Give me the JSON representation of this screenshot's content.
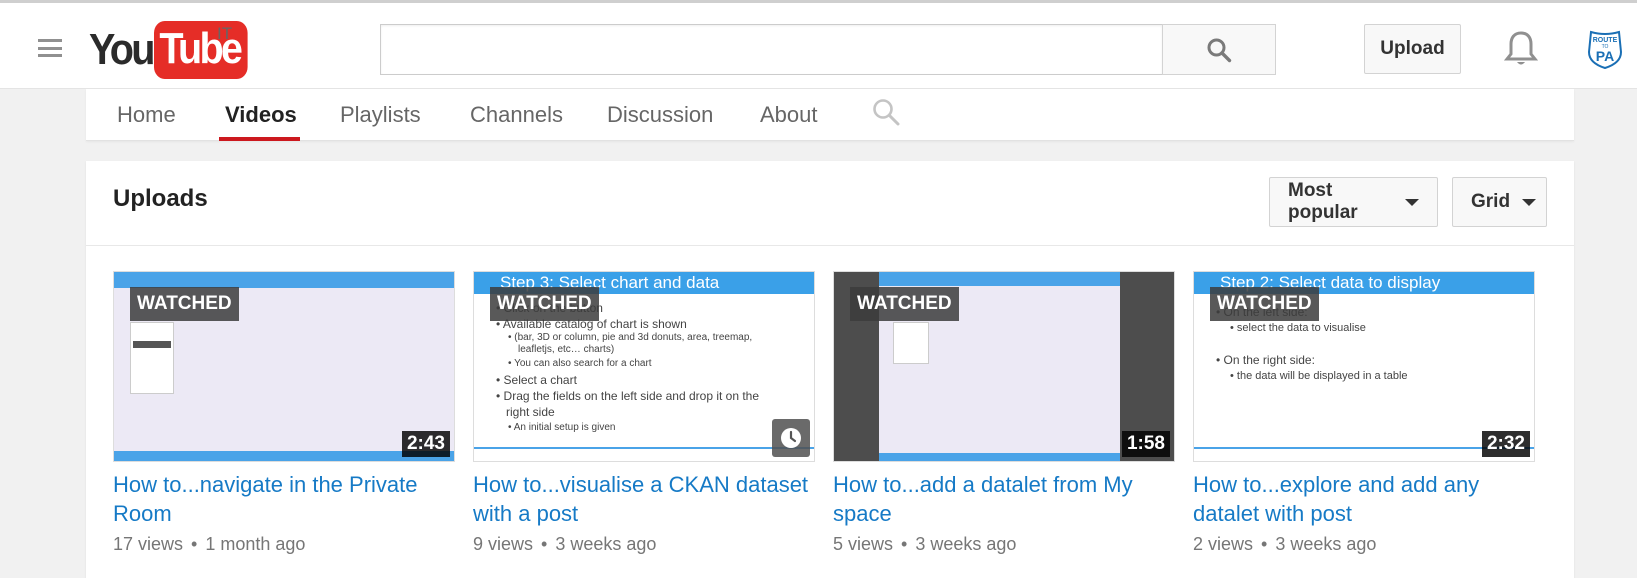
{
  "header": {
    "logo_you": "You",
    "logo_tube": "Tube",
    "logo_country": "IT",
    "search_placeholder": "",
    "upload_label": "Upload"
  },
  "channel_tabs": [
    {
      "label": "Home"
    },
    {
      "label": "Videos"
    },
    {
      "label": "Playlists"
    },
    {
      "label": "Channels"
    },
    {
      "label": "Discussion"
    },
    {
      "label": "About"
    }
  ],
  "active_tab": "Videos",
  "uploads": {
    "title": "Uploads",
    "sort_label": "Most popular",
    "view_label": "Grid"
  },
  "videos": [
    {
      "title": "How to...navigate in the Private Room",
      "views": "17 views",
      "age": "1 month ago",
      "duration": "2:43",
      "watched_label": "WATCHED"
    },
    {
      "title": "How to...visualise a CKAN dataset with a post",
      "views": "9 views",
      "age": "3 weeks ago",
      "duration": "",
      "watched_label": "WATCHED",
      "slide_title": "Step 3: Select chart and data",
      "slide_lines": [
        "• Click on the button",
        "• Available catalog of chart is shown",
        "• (bar, 3D or column, pie and 3d donuts, area, treemap,",
        "leafletjs, etc… charts)",
        "• You can also search for a chart",
        "• Select a chart",
        "• Drag the fields on the left side and drop it on the",
        "right side",
        "• An initial setup is given"
      ]
    },
    {
      "title": "How to...add a datalet from My space",
      "views": "5 views",
      "age": "3 weeks ago",
      "duration": "1:58",
      "watched_label": "WATCHED"
    },
    {
      "title": "How to...explore and add any datalet with post",
      "views": "2 views",
      "age": "3 weeks ago",
      "duration": "2:32",
      "watched_label": "WATCHED",
      "slide_title": "Step 2: Select data to display",
      "slide_lines": [
        "• On the left side:",
        "• select the data to visualise",
        "",
        "• On the right side:",
        "• the data will be displayed in a table"
      ]
    }
  ],
  "colors": {
    "brand_red": "#e52d27",
    "link_blue": "#167ac6",
    "tab_underline": "#cc181e"
  },
  "icons": [
    "menu-icon",
    "search-icon",
    "bell-icon",
    "avatar-route-to-pa",
    "clock-icon",
    "caret-down-icon"
  ],
  "avatar_text": [
    "ROUTE",
    "TO",
    "PA"
  ]
}
